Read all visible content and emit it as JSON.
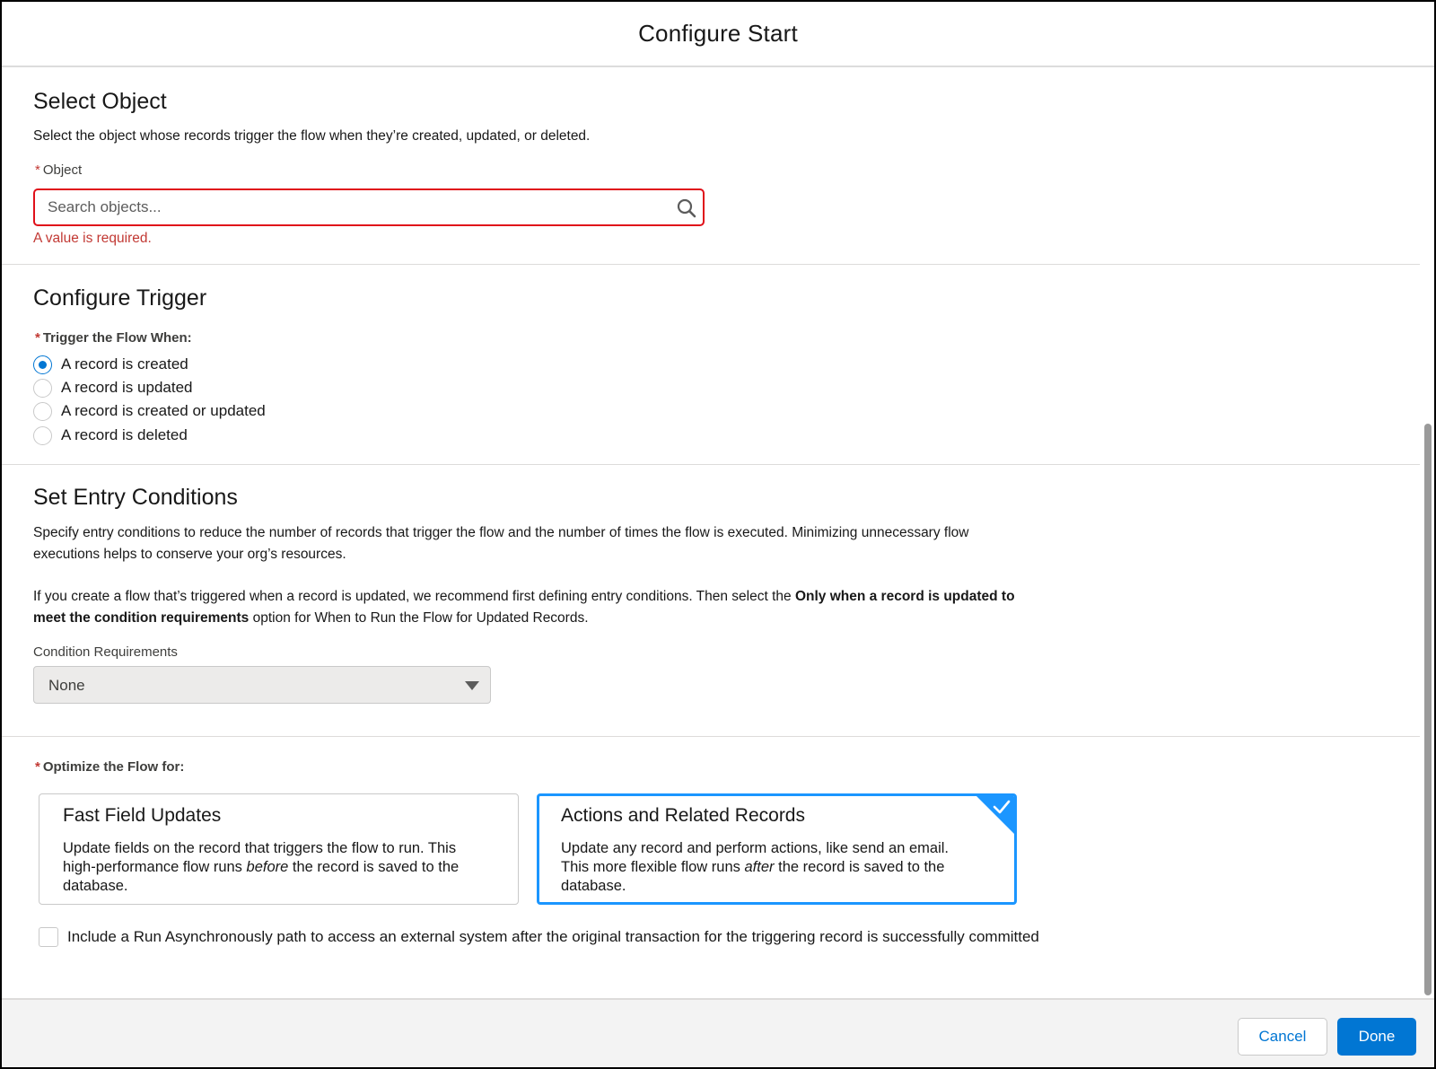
{
  "header": {
    "title": "Configure Start"
  },
  "select_object": {
    "title": "Select Object",
    "description": "Select the object whose records trigger the flow when they’re created, updated, or deleted.",
    "required_mark": "*",
    "field_label": "Object",
    "search_placeholder": "Search objects...",
    "search_value": "",
    "error": "A value is required."
  },
  "configure_trigger": {
    "title": "Configure Trigger",
    "required_mark": "*",
    "field_label": "Trigger the Flow When:",
    "options": [
      {
        "label": "A record is created",
        "checked": true
      },
      {
        "label": "A record is updated",
        "checked": false
      },
      {
        "label": "A record is created or updated",
        "checked": false
      },
      {
        "label": "A record is deleted",
        "checked": false
      }
    ]
  },
  "entry_conditions": {
    "title": "Set Entry Conditions",
    "desc1": "Specify entry conditions to reduce the number of records that trigger the flow and the number of times the flow is executed. Minimizing unnecessary flow executions helps to conserve your org’s resources.",
    "desc2_pre": "If you create a flow that’s triggered when a record is updated, we recommend first defining entry conditions. Then select the ",
    "desc2_bold": "Only when a record is updated to meet the condition requirements",
    "desc2_post": " option for When to Run the Flow for Updated Records.",
    "condition_label": "Condition Requirements",
    "condition_value": "None"
  },
  "optimize": {
    "required_mark": "*",
    "field_label": "Optimize the Flow for:",
    "cards": [
      {
        "title": "Fast Field Updates",
        "desc_pre": "Update fields on the record that triggers the flow to run. This high-performance flow runs ",
        "desc_em": "before",
        "desc_post": " the record is saved to the database.",
        "selected": false
      },
      {
        "title": "Actions and Related Records",
        "desc_pre": "Update any record and perform actions, like send an email. This more flexible flow runs ",
        "desc_em": "after",
        "desc_post": " the record is saved to the database.",
        "selected": true
      }
    ],
    "async_label": "Include a Run Asynchronously path to access an external system after the original transaction for the triggering record is successfully committed",
    "async_checked": false
  },
  "footer": {
    "cancel_label": "Cancel",
    "done_label": "Done"
  },
  "colors": {
    "brand": "#0176d3",
    "error": "#c23934",
    "selected_border": "#1b96ff"
  }
}
